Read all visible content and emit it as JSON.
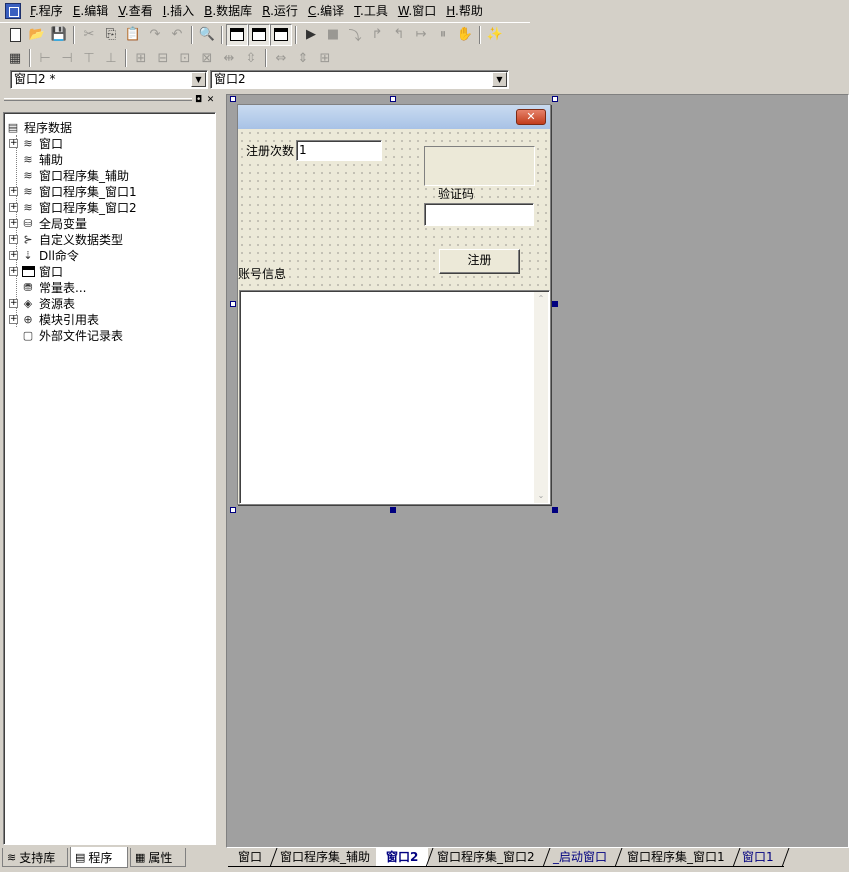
{
  "menu": [
    {
      "key": "F",
      "label": ".程序"
    },
    {
      "key": "E",
      "label": ".编辑"
    },
    {
      "key": "V",
      "label": ".查看"
    },
    {
      "key": "I",
      "label": ".插入"
    },
    {
      "key": "B",
      "label": ".数据库"
    },
    {
      "key": "R",
      "label": ".运行"
    },
    {
      "key": "C",
      "label": ".编译"
    },
    {
      "key": "T",
      "label": ".工具"
    },
    {
      "key": "W",
      "label": ".窗口"
    },
    {
      "key": "H",
      "label": ".帮助"
    }
  ],
  "combos": {
    "left_value": "窗口2 *",
    "right_value": "窗口2"
  },
  "tree": {
    "root": "程序数据",
    "items": [
      {
        "label": "窗口",
        "expandable": true,
        "icon": "stack-icon"
      },
      {
        "label": "辅助",
        "expandable": false,
        "icon": "stack-icon"
      },
      {
        "label": "窗口程序集_辅助",
        "expandable": false,
        "icon": "stack-icon"
      },
      {
        "label": "窗口程序集_窗口1",
        "expandable": true,
        "icon": "stack-icon"
      },
      {
        "label": "窗口程序集_窗口2",
        "expandable": true,
        "icon": "stack-icon"
      },
      {
        "label": "全局变量",
        "expandable": true,
        "icon": "jar-icon"
      },
      {
        "label": "自定义数据类型",
        "expandable": true,
        "icon": "type-icon"
      },
      {
        "label": "Dll命令",
        "expandable": true,
        "icon": "dll-icon"
      },
      {
        "label": "窗口",
        "expandable": true,
        "icon": "window-icon"
      },
      {
        "label": "常量表...",
        "expandable": false,
        "icon": "database-icon"
      },
      {
        "label": "资源表",
        "expandable": true,
        "icon": "resource-icon"
      },
      {
        "label": "模块引用表",
        "expandable": true,
        "icon": "module-icon"
      },
      {
        "label": "外部文件记录表",
        "expandable": false,
        "icon": "file-icon"
      }
    ]
  },
  "left_tabs": [
    "支持库",
    "程序",
    "属性"
  ],
  "designer": {
    "close_glyph": "✕",
    "reg_count_label": "注册次数",
    "reg_count_value": "1",
    "captcha_label": "验证码",
    "captcha_value": "",
    "account_label": "账号信息",
    "register_button": "注册",
    "scroll_up": "⌃",
    "scroll_down": "⌄"
  },
  "doc_tabs": [
    {
      "label": "窗口",
      "state": "normal"
    },
    {
      "label": "窗口程序集_辅助",
      "state": "normal"
    },
    {
      "label": "窗口2",
      "state": "active"
    },
    {
      "label": "窗口程序集_窗口2",
      "state": "normal"
    },
    {
      "label": "_启动窗口",
      "state": "blue"
    },
    {
      "label": "窗口程序集_窗口1",
      "state": "normal"
    },
    {
      "label": "窗口1",
      "state": "blue"
    }
  ]
}
